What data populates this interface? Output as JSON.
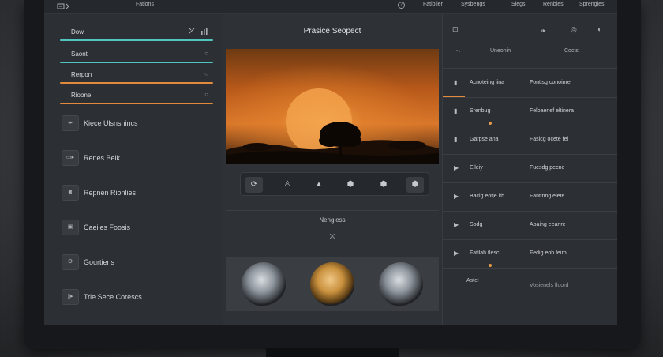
{
  "topbar": {
    "title": "Fatlons",
    "menu": [
      "Fatlbiler",
      "Sysbengs",
      "Siegs",
      "Renbies",
      "Sprengies"
    ]
  },
  "left": {
    "fields": [
      {
        "label": "Dow",
        "accent": "#4ec5c1"
      },
      {
        "label": "Saont",
        "accent": "#4ec5c1"
      },
      {
        "label": "Rerpon",
        "accent": "#e08a3a"
      },
      {
        "label": "Rioone",
        "accent": "#e08a3a"
      }
    ],
    "nav": [
      {
        "label": "Kiece Ulsnsnincs",
        "icon": "grid-icon"
      },
      {
        "label": "Renes Beik",
        "icon": "folder-icon"
      },
      {
        "label": "Repnen Rionlies",
        "icon": "image-icon"
      },
      {
        "label": "Caeiies Foosis",
        "icon": "film-icon"
      },
      {
        "label": "Gourtiens",
        "icon": "gear-icon"
      },
      {
        "label": "Trie Sece Corescs",
        "icon": "frame-icon"
      }
    ]
  },
  "center": {
    "title": "Prasice Seopect",
    "sub_title": "Nengiess",
    "close_glyph": "✕",
    "tools": [
      "refresh-icon",
      "hat-icon",
      "person-icon",
      "shield-icon",
      "hexagon-icon",
      "hexagon-alt-icon"
    ],
    "knobs": [
      {
        "name": "left-knob",
        "color": "#9aa1a8"
      },
      {
        "name": "center-knob",
        "color": "#c9913e"
      },
      {
        "name": "right-knob",
        "color": "#9aa1a8"
      }
    ]
  },
  "right": {
    "header_left": "Uneonin",
    "header_right": "Cocts",
    "rows": [
      {
        "a": "Acnoteing iina",
        "b": "Fontisg conoinre",
        "icon": "play-icon",
        "has_dot": false
      },
      {
        "a": "Srenbug",
        "b": "Feloaenef eltinera",
        "icon": "play-icon",
        "has_dot": true
      },
      {
        "a": "Garpse ana",
        "b": "Fasicg ocete fel",
        "icon": "play-icon",
        "has_dot": false
      },
      {
        "a": "Elleiy",
        "b": "Fuesdg pecne",
        "icon": "play-icon",
        "has_dot": false
      },
      {
        "a": "Bacig eotje ith",
        "b": "Fantinng eiete",
        "icon": "play-icon",
        "has_dot": false
      },
      {
        "a": "Sodg",
        "b": "Aoaing eeanre",
        "icon": "play-icon",
        "has_dot": false
      },
      {
        "a": "Fatilah tlesc",
        "b": "Fedig eoh feiro",
        "icon": "play-icon",
        "has_dot": true
      }
    ],
    "footer_left": "Astel",
    "footer_right": "Vosienels fluord"
  }
}
